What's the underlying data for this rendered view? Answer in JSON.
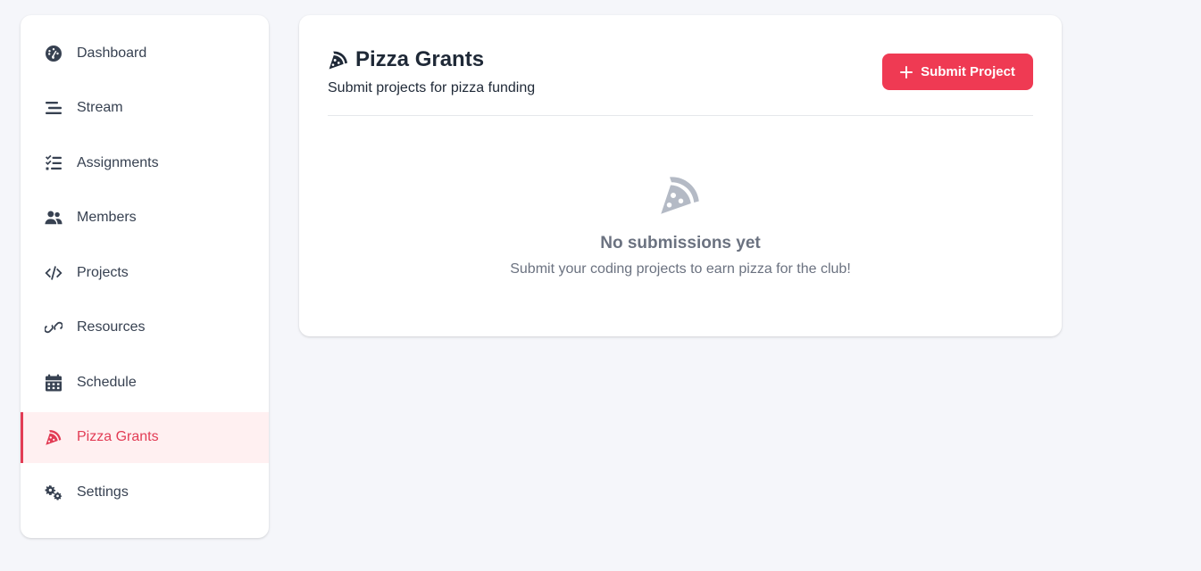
{
  "sidebar": {
    "items": [
      {
        "label": "Dashboard",
        "icon": "dashboard-icon",
        "active": false
      },
      {
        "label": "Stream",
        "icon": "stream-icon",
        "active": false
      },
      {
        "label": "Assignments",
        "icon": "assignments-icon",
        "active": false
      },
      {
        "label": "Members",
        "icon": "members-icon",
        "active": false
      },
      {
        "label": "Projects",
        "icon": "code-icon",
        "active": false
      },
      {
        "label": "Resources",
        "icon": "link-icon",
        "active": false
      },
      {
        "label": "Schedule",
        "icon": "calendar-icon",
        "active": false
      },
      {
        "label": "Pizza Grants",
        "icon": "pizza-icon",
        "active": true
      },
      {
        "label": "Settings",
        "icon": "gears-icon",
        "active": false
      }
    ]
  },
  "main": {
    "title": "Pizza Grants",
    "subtitle": "Submit projects for pizza funding",
    "submit_label": "Submit Project",
    "empty_title": "No submissions yet",
    "empty_text": "Submit your coding projects to earn pizza for the club!"
  },
  "colors": {
    "accent": "#ef3a53",
    "active_bg": "#fff0f1",
    "text": "#1f2937",
    "muted": "#6b7280"
  }
}
